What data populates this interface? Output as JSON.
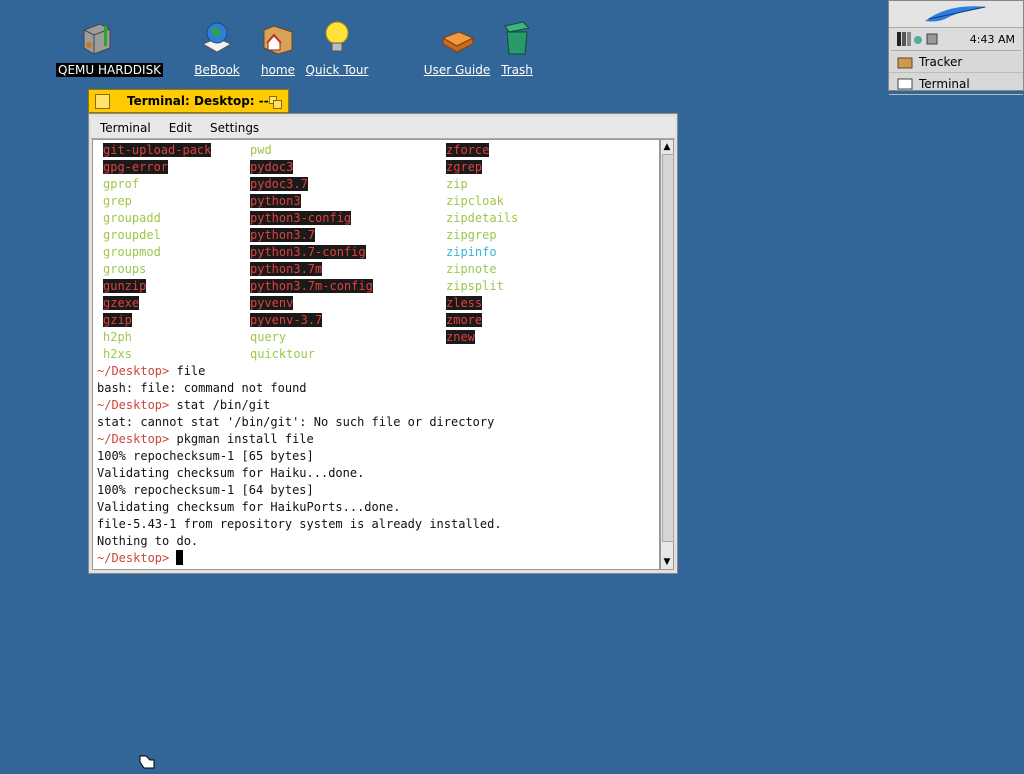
{
  "desktop_icons": [
    {
      "label": "QEMU HARDDISK",
      "icon": "harddisk-icon"
    },
    {
      "label": "BeBook",
      "icon": "globe-book-icon"
    },
    {
      "label": "home",
      "icon": "home-folder-icon"
    },
    {
      "label": "Quick Tour",
      "icon": "lightbulb-icon"
    },
    {
      "label": "User Guide",
      "icon": "book-icon"
    },
    {
      "label": "Trash",
      "icon": "trash-icon"
    }
  ],
  "deskbar": {
    "clock": "4:43 AM",
    "apps": [
      {
        "label": "Tracker"
      },
      {
        "label": "Terminal"
      }
    ]
  },
  "window": {
    "title": "Terminal: Desktop: --",
    "menu": [
      "Terminal",
      "Edit",
      "Settings"
    ]
  },
  "listing": {
    "col1": [
      {
        "t": "git-upload-pack",
        "s": "red"
      },
      {
        "t": "gpg-error",
        "s": "red"
      },
      {
        "t": "gprof",
        "s": "grn"
      },
      {
        "t": "grep",
        "s": "grn"
      },
      {
        "t": "groupadd",
        "s": "grn"
      },
      {
        "t": "groupdel",
        "s": "grn"
      },
      {
        "t": "groupmod",
        "s": "grn"
      },
      {
        "t": "groups",
        "s": "grn"
      },
      {
        "t": "gunzip",
        "s": "red"
      },
      {
        "t": "gzexe",
        "s": "red"
      },
      {
        "t": "gzip",
        "s": "red"
      },
      {
        "t": "h2ph",
        "s": "grn"
      },
      {
        "t": "h2xs",
        "s": "grn"
      }
    ],
    "col2": [
      {
        "t": "pwd",
        "s": "grn"
      },
      {
        "t": "pydoc3",
        "s": "red"
      },
      {
        "t": "pydoc3.7",
        "s": "red"
      },
      {
        "t": "python3",
        "s": "red"
      },
      {
        "t": "python3-config",
        "s": "red"
      },
      {
        "t": "python3.7",
        "s": "red"
      },
      {
        "t": "python3.7-config",
        "s": "red"
      },
      {
        "t": "python3.7m",
        "s": "red"
      },
      {
        "t": "python3.7m-config",
        "s": "red"
      },
      {
        "t": "pyvenv",
        "s": "red"
      },
      {
        "t": "pyvenv-3.7",
        "s": "red"
      },
      {
        "t": "query",
        "s": "grn"
      },
      {
        "t": "quicktour",
        "s": "grn"
      }
    ],
    "col3": [
      {
        "t": "zforce",
        "s": "red"
      },
      {
        "t": "zgrep",
        "s": "red"
      },
      {
        "t": "zip",
        "s": "grn"
      },
      {
        "t": "zipcloak",
        "s": "grn"
      },
      {
        "t": "zipdetails",
        "s": "grn"
      },
      {
        "t": "zipgrep",
        "s": "grn"
      },
      {
        "t": "zipinfo",
        "s": "cyn"
      },
      {
        "t": "zipnote",
        "s": "grn"
      },
      {
        "t": "zipsplit",
        "s": "grn"
      },
      {
        "t": "zless",
        "s": "red"
      },
      {
        "t": "zmore",
        "s": "red"
      },
      {
        "t": "znew",
        "s": "red"
      }
    ]
  },
  "session": [
    {
      "prompt": "~/Desktop>",
      "cmd": " file"
    },
    {
      "text": "bash: file: command not found"
    },
    {
      "prompt": "~/Desktop>",
      "cmd": " stat /bin/git"
    },
    {
      "text": "stat: cannot stat '/bin/git': No such file or directory"
    },
    {
      "prompt": "~/Desktop>",
      "cmd": " pkgman install file"
    },
    {
      "text": "100% repochecksum-1 [65 bytes]"
    },
    {
      "text": "Validating checksum for Haiku...done."
    },
    {
      "text": "100% repochecksum-1 [64 bytes]"
    },
    {
      "text": "Validating checksum for HaikuPorts...done."
    },
    {
      "text": "file-5.43-1 from repository system is already installed."
    },
    {
      "text": "Nothing to do."
    },
    {
      "prompt": "~/Desktop>",
      "cmd": " "
    }
  ]
}
